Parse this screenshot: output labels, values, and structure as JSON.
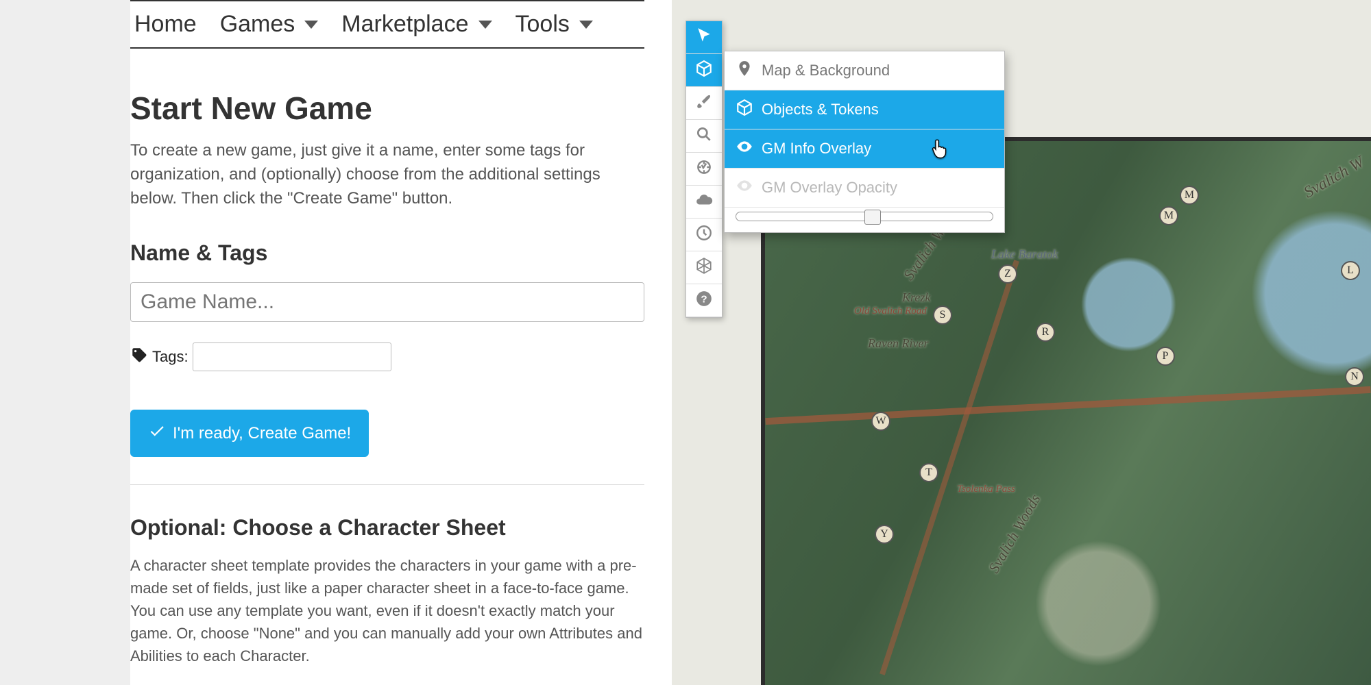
{
  "nav": {
    "home": "Home",
    "games": "Games",
    "marketplace": "Marketplace",
    "tools": "Tools"
  },
  "page": {
    "title": "Start New Game",
    "intro": "To create a new game, just give it a name, enter some tags for organization, and (optionally) choose from the additional settings below. Then click the \"Create Game\" button.",
    "name_tags_heading": "Name & Tags",
    "game_name_placeholder": "Game Name...",
    "tags_label": "Tags:",
    "create_button": "I'm ready, Create Game!",
    "sheet_heading": "Optional: Choose a Character Sheet",
    "sheet_desc": "A character sheet template provides the characters in your game with a pre-made set of fields, just like a paper character sheet in a face-to-face game. You can use any template you want, even if it doesn't exactly match your game. Or, choose \"None\" and you can manually add your own Attributes and Abilities to each Character."
  },
  "vtt": {
    "toolbar": {
      "icons": [
        "cursor",
        "cube",
        "brush",
        "zoom",
        "measure",
        "fog",
        "turn",
        "dice",
        "help"
      ],
      "active_index": 1
    },
    "layers": {
      "map_bg": "Map & Background",
      "objects": "Objects & Tokens",
      "gm_overlay": "GM Info Overlay",
      "opacity_label": "GM Overlay Opacity",
      "selected": [
        "objects",
        "gm_overlay"
      ],
      "opacity_value": 50
    },
    "map": {
      "labels": {
        "svalich_woods_1": "Svalich Woods",
        "svalich_woods_2": "Svalich Woods",
        "svalich_woods_3": "Svalich W",
        "lake_baratok": "Lake Baratok",
        "raven_river": "Raven River",
        "old_svalich_road": "Old Svalich Road",
        "krezk": "Krezk",
        "tsolenka_pass": "Tsolenka Pass"
      },
      "pins": [
        "Z",
        "S",
        "W",
        "T",
        "Y",
        "R",
        "P",
        "M",
        "M",
        "L",
        "N"
      ]
    }
  },
  "colors": {
    "accent": "#1ca8e8"
  }
}
